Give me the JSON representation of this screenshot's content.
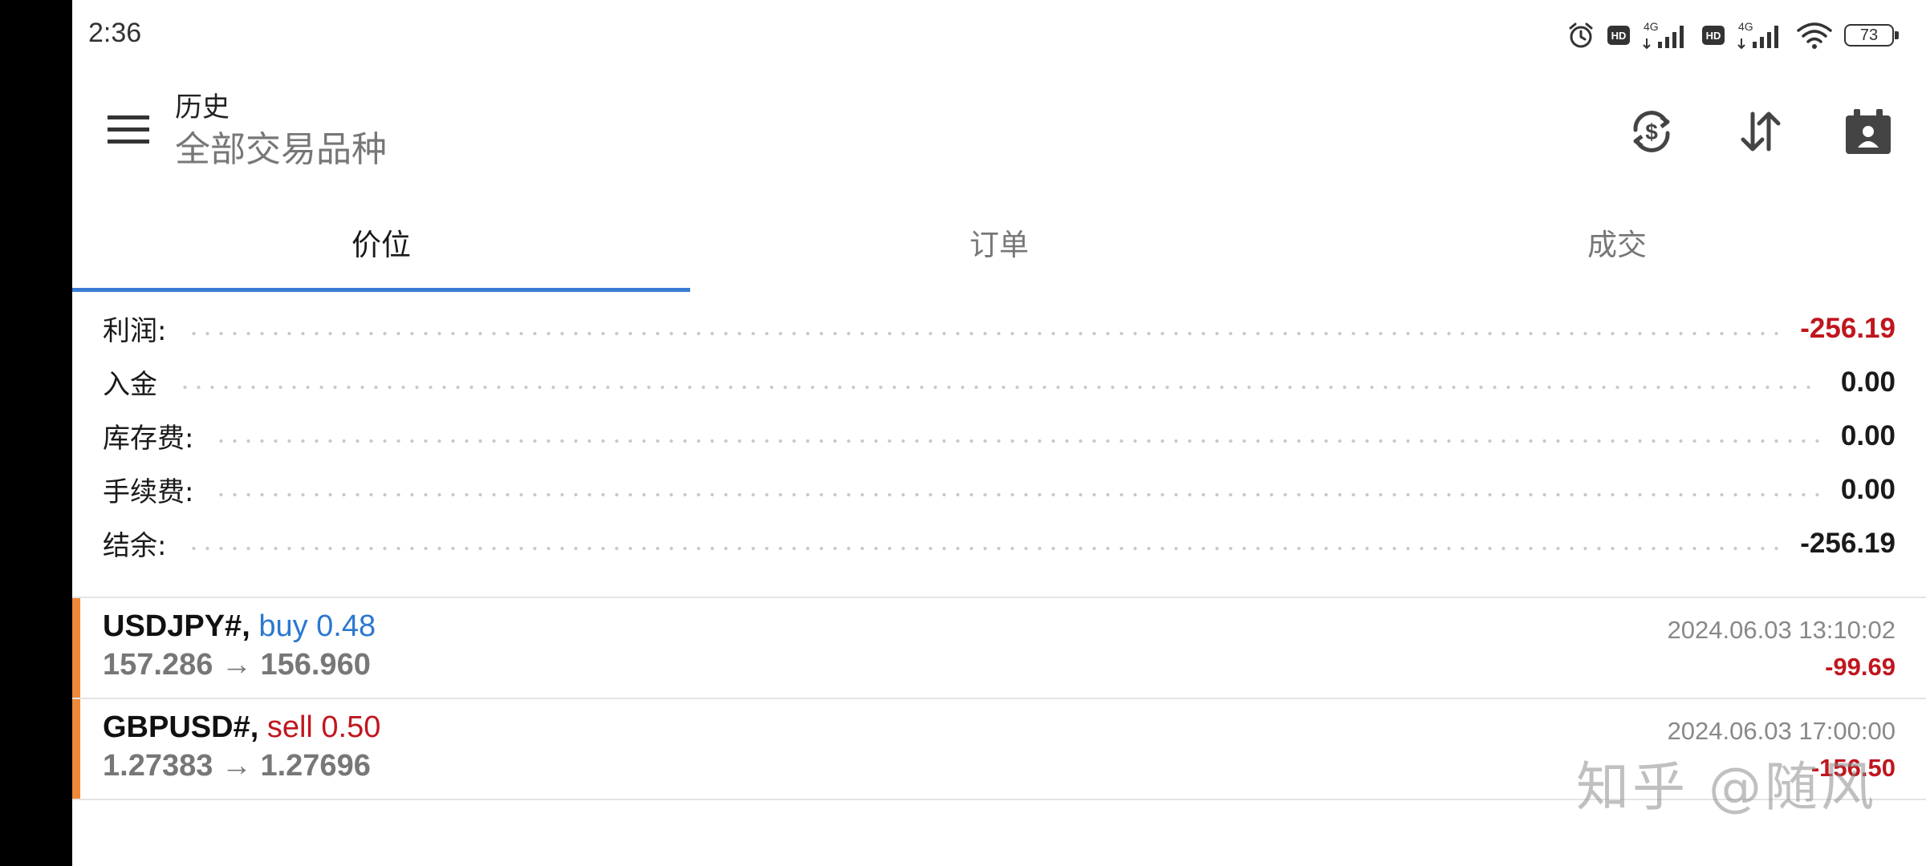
{
  "status_bar": {
    "time": "2:36",
    "icons": [
      "alarm-icon",
      "hd-icon",
      "signal-4g-icon",
      "hd-icon",
      "signal-4g-icon",
      "wifi-icon",
      "battery-icon"
    ],
    "network_label": "4G",
    "hd_label": "HD",
    "battery": "73"
  },
  "app_bar": {
    "title": "历史",
    "subtitle": "全部交易品种",
    "actions": [
      "currency-sync-icon",
      "sort-icon",
      "journal-icon"
    ]
  },
  "tabs": [
    {
      "label": "价位",
      "active": true
    },
    {
      "label": "订单",
      "active": false
    },
    {
      "label": "成交",
      "active": false
    }
  ],
  "summary": [
    {
      "label": "利润:",
      "value": "-256.19",
      "color": "#c0161e"
    },
    {
      "label": "入金",
      "value": "0.00",
      "color": "#1a1a1a"
    },
    {
      "label": "库存费:",
      "value": "0.00",
      "color": "#1a1a1a"
    },
    {
      "label": "手续费:",
      "value": "0.00",
      "color": "#1a1a1a"
    },
    {
      "label": "结余:",
      "value": "-256.19",
      "color": "#1a1a1a"
    }
  ],
  "trades": [
    {
      "symbol": "USDJPY#,",
      "side": "buy 0.48",
      "side_type": "buy",
      "prices": "157.286 → 156.960",
      "time": "2024.06.03 13:10:02",
      "profit": "-99.69"
    },
    {
      "symbol": "GBPUSD#,",
      "side": "sell 0.50",
      "side_type": "sell",
      "prices": "1.27383 → 1.27696",
      "time": "2024.06.03 17:00:00",
      "profit": "-156.50"
    }
  ],
  "watermark": "知乎 @随风",
  "colors": {
    "accent": "#3a7bd5",
    "buy": "#2b78cf",
    "sell_negative": "#c0161e",
    "trade_marker": "#f0883a"
  }
}
